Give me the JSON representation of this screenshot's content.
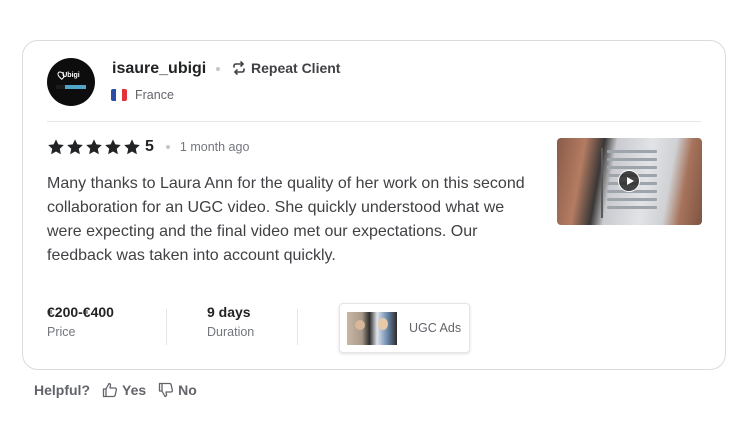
{
  "review": {
    "username": "isaure_ubigi",
    "avatar_logo_text": "Ubigi",
    "repeat_client_label": "Repeat Client",
    "country": "France",
    "rating": "5",
    "stars": 5,
    "time_ago": "1 month ago",
    "text": "Many thanks to Laura Ann for the quality of her work on this second collaboration for an UGC video. She quickly understood what we were expecting and the final video met our expectations. Our feedback was taken into account quickly.",
    "price": {
      "value": "€200-€400",
      "label": "Price"
    },
    "duration": {
      "value": "9 days",
      "label": "Duration"
    },
    "gig": {
      "label": "UGC Ads"
    }
  },
  "helpful": {
    "question": "Helpful?",
    "yes_label": "Yes",
    "no_label": "No"
  },
  "icons": {
    "repeat": "repeat-icon",
    "star": "star-icon",
    "play": "play-icon",
    "thumbs_up": "thumbs-up-icon",
    "thumbs_down": "thumbs-down-icon"
  },
  "colors": {
    "text_primary": "#222325",
    "text_secondary": "#74767e",
    "border": "#dadbdd",
    "star": "#222325"
  }
}
